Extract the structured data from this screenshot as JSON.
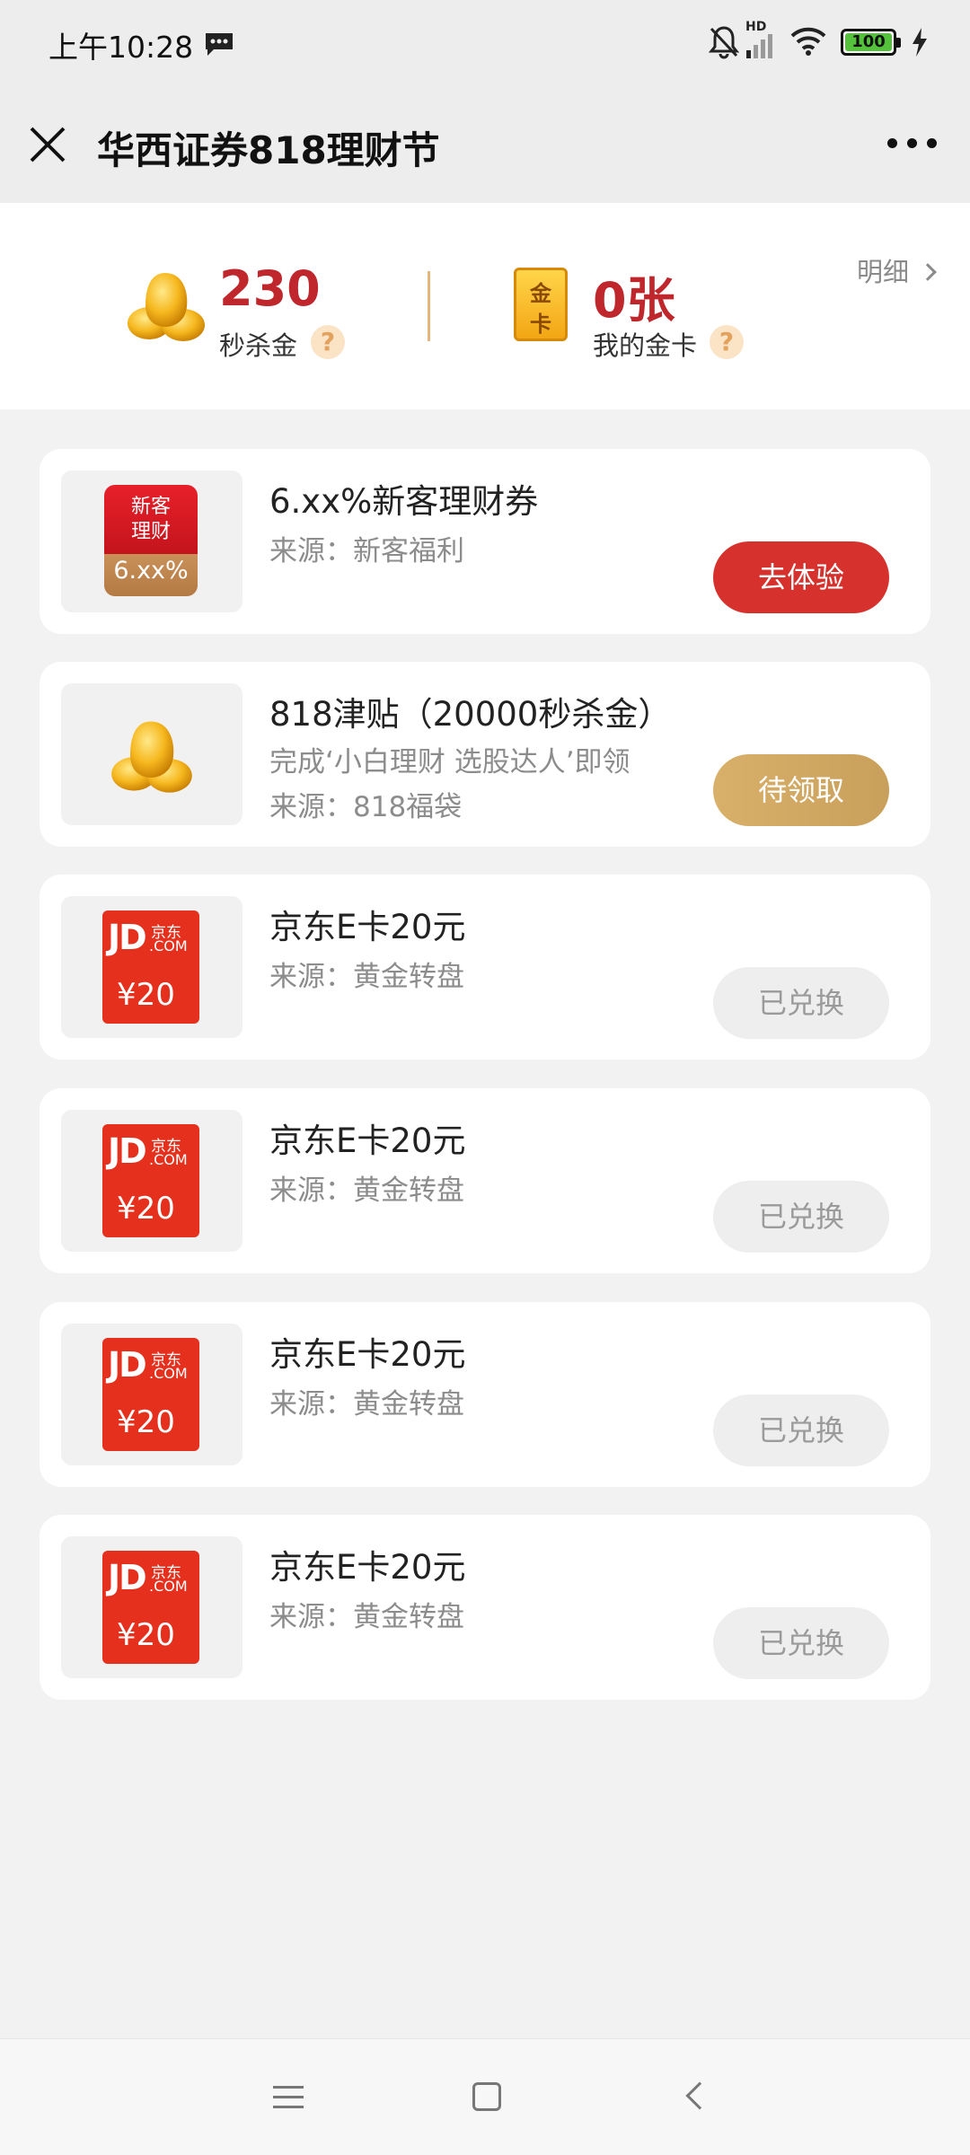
{
  "status_bar": {
    "time": "上午10:28",
    "network": "HD",
    "battery": "100",
    "icons": [
      "message-icon",
      "mute-bell-icon",
      "signal-icon",
      "wifi-icon",
      "battery-icon",
      "charging-icon"
    ]
  },
  "title_bar": {
    "title": "华西证券818理财节",
    "icons": [
      "close-icon",
      "more-icon"
    ]
  },
  "summary": {
    "gold": {
      "value": "230",
      "label": "秒杀金"
    },
    "card": {
      "value": "0张",
      "label": "我的金卡",
      "icon_text_top": "金",
      "icon_text_bottom": "卡"
    },
    "help_symbol": "?",
    "detail_label": "明细"
  },
  "items": [
    {
      "title": "6.xx%新客理财券",
      "subtitle": "",
      "source": "来源：新客福利",
      "action": "去体验",
      "thumb": {
        "line1": "新客",
        "line2": "理财",
        "rate": "6.xx%"
      }
    },
    {
      "title": "818津贴（20000秒杀金）",
      "subtitle": "完成‘小白理财 选股达人’即领",
      "source": "来源：818福袋",
      "action": "待领取"
    },
    {
      "title": "京东E卡20元",
      "source": "来源：黄金转盘",
      "action": "已兑换"
    },
    {
      "title": "京东E卡20元",
      "source": "来源：黄金转盘",
      "action": "已兑换"
    },
    {
      "title": "京东E卡20元",
      "source": "来源：黄金转盘",
      "action": "已兑换"
    },
    {
      "title": "京东E卡20元",
      "source": "来源：黄金转盘",
      "action": "已兑换"
    }
  ],
  "jd_thumb": {
    "logo": "JD",
    "cn": "京东",
    "com": ".COM",
    "price": "¥20"
  },
  "colors": {
    "accent_red": "#d6312c",
    "gold": "#c9a05b",
    "value_red": "#c0272d",
    "jd_red": "#e5301d"
  }
}
